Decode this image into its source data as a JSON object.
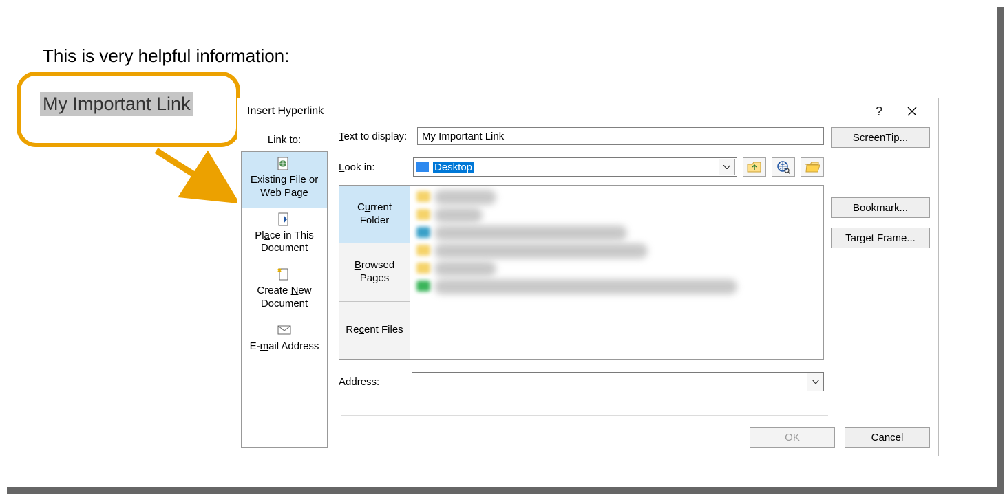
{
  "document": {
    "paragraph": "This is very helpful information:",
    "selected_text": "My Important Link"
  },
  "dialog": {
    "title": "Insert Hyperlink",
    "help_symbol": "?",
    "link_to_label": "Link to:",
    "linkto": [
      {
        "label_pre": "E",
        "label_key": "x",
        "label_post": "isting File or Web Page"
      },
      {
        "label_pre": "Pl",
        "label_key": "a",
        "label_post": "ce in This Document"
      },
      {
        "label_pre": "Create ",
        "label_key": "N",
        "label_post": "ew Document"
      },
      {
        "label_pre": "E-",
        "label_key": "m",
        "label_post": "ail Address"
      }
    ],
    "text_to_display": {
      "label_pre": "",
      "label_key": "T",
      "label_post": "ext to display:",
      "value": "My Important Link"
    },
    "look_in": {
      "label_pre": "",
      "label_key": "L",
      "label_post": "ook in:",
      "value": "Desktop"
    },
    "browse_tabs": [
      {
        "label_pre": "C",
        "label_key": "u",
        "label_post": "rrent Folder"
      },
      {
        "label_pre": "",
        "label_key": "B",
        "label_post": "rowsed Pages"
      },
      {
        "label_pre": "Re",
        "label_key": "c",
        "label_post": "ent Files"
      }
    ],
    "address": {
      "label_pre": "Addr",
      "label_key": "e",
      "label_post": "ss:",
      "value": ""
    },
    "buttons": {
      "screentip_pre": "ScreenTi",
      "screentip_key": "p",
      "screentip_post": "...",
      "bookmark_pre": "B",
      "bookmark_key": "o",
      "bookmark_post": "okmark...",
      "target_frame_pre": "Tar",
      "target_frame_key": "g",
      "target_frame_post": "et Frame...",
      "ok": "OK",
      "cancel": "Cancel"
    }
  }
}
